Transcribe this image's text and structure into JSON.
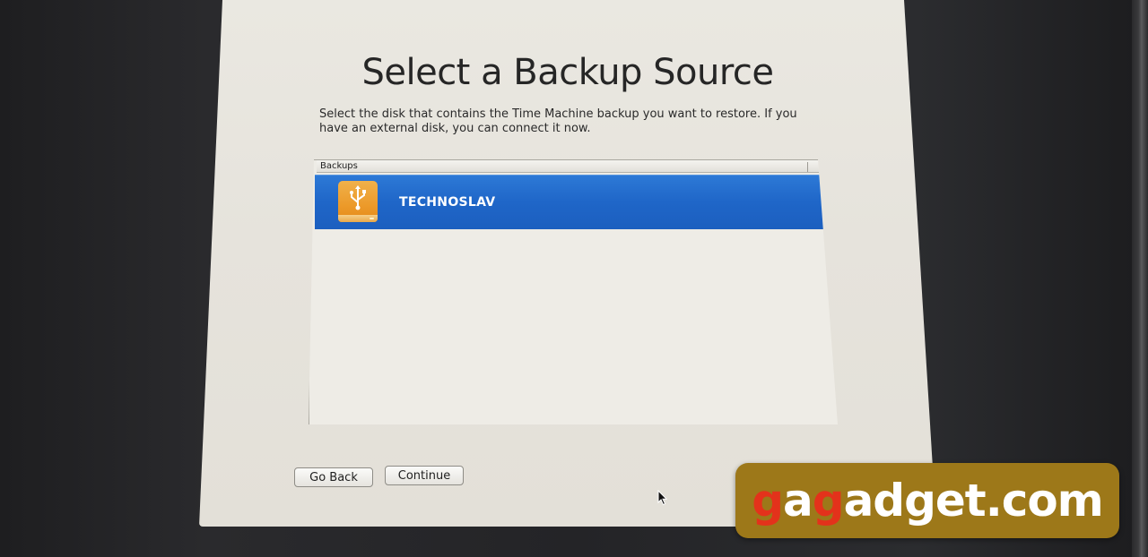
{
  "dialog": {
    "title": "Select a Backup Source",
    "description": "Select the disk that contains the Time Machine backup you want to restore. If you have an external disk, you can connect it now."
  },
  "backups_list": {
    "header": "Backups",
    "items": [
      {
        "name": "TECHNOSLAV",
        "icon": "usb-drive-icon",
        "selected": true
      }
    ]
  },
  "buttons": {
    "go_back": "Go Back",
    "continue": "Continue"
  },
  "watermark": {
    "part1": "g",
    "part2": "a",
    "part3": "g",
    "part4": "adget.com"
  },
  "colors": {
    "selection": "#2369cc",
    "drive": "#ec9a2a",
    "watermark_bg": "#9d7819",
    "watermark_accent": "#e3321b"
  }
}
